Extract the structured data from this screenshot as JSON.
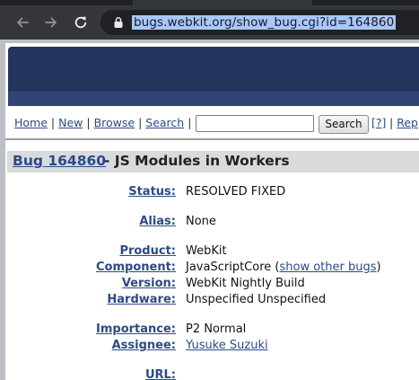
{
  "browser": {
    "url": "bugs.webkit.org/show_bug.cgi?id=164860"
  },
  "nav": {
    "home": "Home",
    "new": "New",
    "browse": "Browse",
    "search": "Search",
    "search_button": "Search",
    "help": "[?]",
    "rep": "Rep",
    "separator": "|"
  },
  "bug": {
    "link": "Bug 164860",
    "title": "- JS Modules in Workers"
  },
  "fields": {
    "status": {
      "label": "Status",
      "value": "RESOLVED FIXED"
    },
    "alias": {
      "label": "Alias",
      "value": "None"
    },
    "product": {
      "label": "Product",
      "value": "WebKit"
    },
    "component": {
      "label": "Component",
      "value": "JavaScriptCore",
      "extra_open": " (",
      "extra_link": "show other bugs",
      "extra_close": ")"
    },
    "version": {
      "label": "Version",
      "value": "WebKit Nightly Build"
    },
    "hardware": {
      "label": "Hardware",
      "value": "Unspecified Unspecified"
    },
    "importance": {
      "label": "Importance",
      "value": "P2 Normal"
    },
    "assignee": {
      "label": "Assignee",
      "value": "Yusuke Suzuki"
    },
    "url": {
      "label": "URL",
      "value": ""
    }
  }
}
